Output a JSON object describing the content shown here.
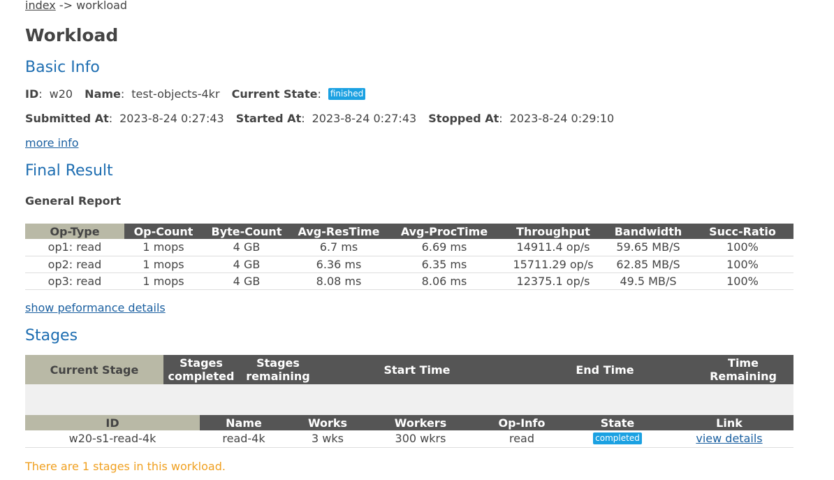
{
  "breadcrumb": {
    "home": "index",
    "sep": "->",
    "current": "workload"
  },
  "page_title": "Workload",
  "basic": {
    "heading": "Basic Info",
    "id_label": "ID",
    "id": "w20",
    "name_label": "Name",
    "name": "test-objects-4kr",
    "state_label": "Current State",
    "state": "finished",
    "submitted_label": "Submitted At",
    "submitted": "2023-8-24 0:27:43",
    "started_label": "Started At",
    "started": "2023-8-24 0:27:43",
    "stopped_label": "Stopped At",
    "stopped": "2023-8-24 0:29:10",
    "more_info": "more info"
  },
  "final": {
    "heading": "Final Result",
    "report_heading": "General Report",
    "columns": [
      "Op-Type",
      "Op-Count",
      "Byte-Count",
      "Avg-ResTime",
      "Avg-ProcTime",
      "Throughput",
      "Bandwidth",
      "Succ-Ratio"
    ],
    "rows": [
      [
        "op1: read",
        "1 mops",
        "4 GB",
        "6.7 ms",
        "6.69 ms",
        "14911.4 op/s",
        "59.65 MB/S",
        "100%"
      ],
      [
        "op2: read",
        "1 mops",
        "4 GB",
        "6.36 ms",
        "6.35 ms",
        "15711.29 op/s",
        "62.85 MB/S",
        "100%"
      ],
      [
        "op3: read",
        "1 mops",
        "4 GB",
        "8.08 ms",
        "8.06 ms",
        "12375.1 op/s",
        "49.5 MB/S",
        "100%"
      ]
    ],
    "perf_link": "show peformance details"
  },
  "stages": {
    "heading": "Stages",
    "summary_cols": {
      "current_stage": "Current Stage",
      "completed_1": "Stages",
      "completed_2": "completed",
      "remaining_1": "Stages",
      "remaining_2": "remaining",
      "start_time": "Start Time",
      "end_time": "End Time",
      "time_remaining_1": "Time",
      "time_remaining_2": "Remaining"
    },
    "list_cols": {
      "id": "ID",
      "name": "Name",
      "works": "Works",
      "workers": "Workers",
      "op_info": "Op-Info",
      "state": "State",
      "link": "Link"
    },
    "row": {
      "id": "w20-s1-read-4k",
      "name": "read-4k",
      "works": "3 wks",
      "workers": "300 wkrs",
      "op_info": "read",
      "state": "completed",
      "link": "view details"
    },
    "count_note": "There are 1 stages in this workload."
  },
  "colors": {
    "heading_blue": "#1d6db1",
    "table_header": "#555555",
    "olive_header": "#b9b9a6",
    "badge": "#1ba1e2",
    "note_orange": "#f0a020"
  }
}
